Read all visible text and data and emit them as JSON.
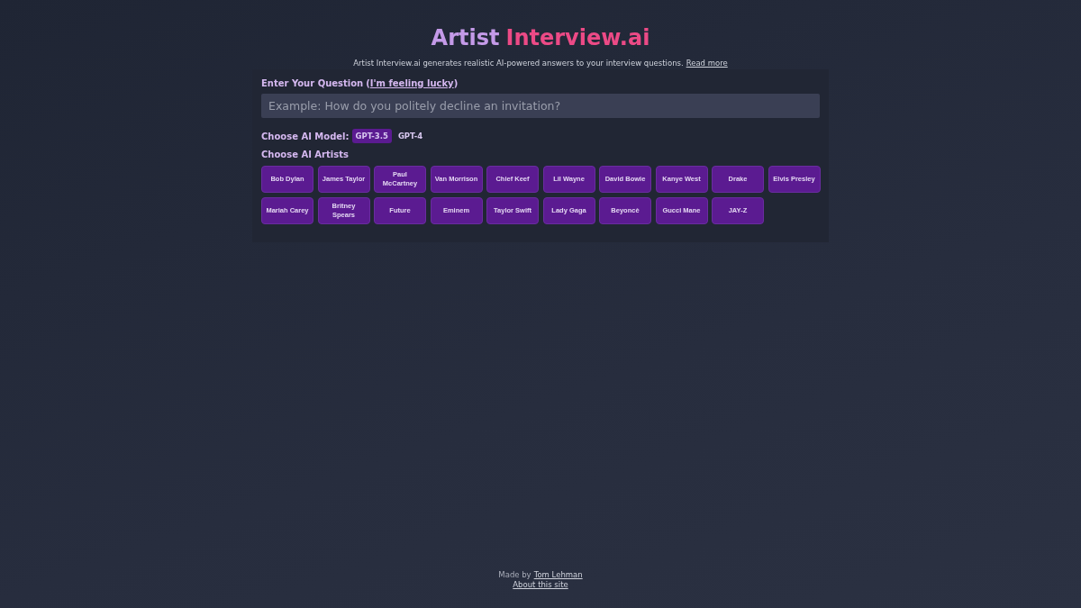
{
  "header": {
    "title_part_1": "Artist",
    "title_part_2": "Interview.ai",
    "description": "Artist Interview.ai generates realistic AI-powered answers to your interview questions.",
    "read_more_link": "Read more"
  },
  "question": {
    "label": "Enter Your Question",
    "open_paren": "(",
    "lucky_link": "I'm feeling lucky",
    "close_paren": ")",
    "placeholder": "Example: How do you politely decline an invitation?"
  },
  "model": {
    "label": "Choose AI Model:",
    "options": [
      {
        "label": "GPT-3.5",
        "selected": true
      },
      {
        "label": "GPT-4",
        "selected": false
      }
    ]
  },
  "artists": {
    "label": "Choose AI Artists",
    "items": [
      "Bob Dylan",
      "James Taylor",
      "Paul McCartney",
      "Van Morrison",
      "Chief Keef",
      "Lil Wayne",
      "David Bowie",
      "Kanye West",
      "Drake",
      "Elvis Presley",
      "Mariah Carey",
      "Britney Spears",
      "Future",
      "Eminem",
      "Taylor Swift",
      "Lady Gaga",
      "Beyoncè",
      "Gucci Mane",
      "JAY-Z"
    ]
  },
  "footer": {
    "made_by": "Made by",
    "author_link": "Tom Lehman",
    "about_link": "About this site"
  }
}
